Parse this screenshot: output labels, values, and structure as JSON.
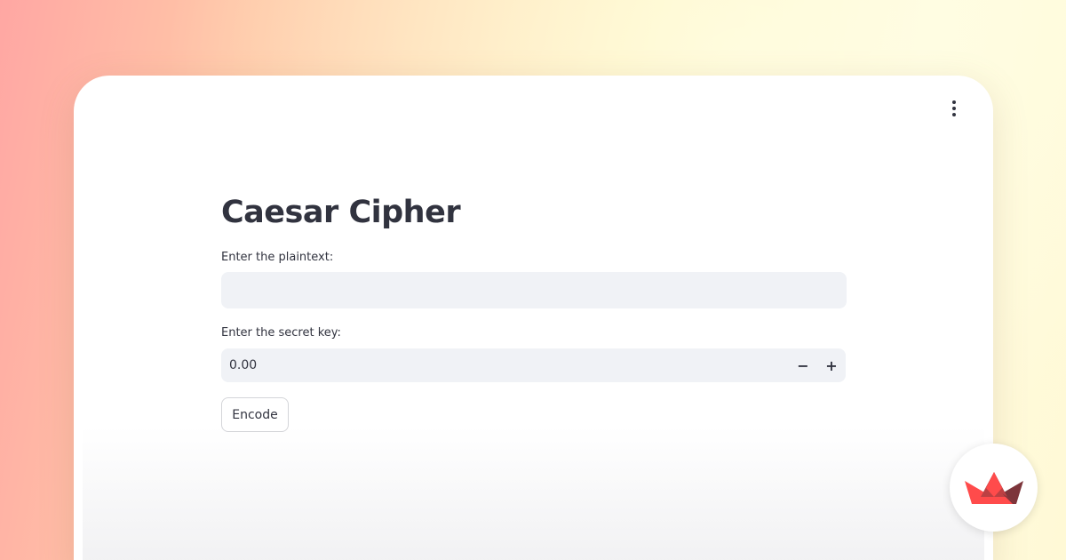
{
  "app": {
    "title": "Caesar Cipher"
  },
  "form": {
    "plaintext_label": "Enter the plaintext:",
    "plaintext_value": "",
    "key_label": "Enter the secret key:",
    "key_value": "0.00",
    "decrement_symbol": "−",
    "increment_symbol": "+",
    "submit_label": "Encode"
  },
  "icons": {
    "menu": "kebab-menu-icon",
    "logo": "streamlit-logo"
  },
  "colors": {
    "text": "#31333f",
    "input_bg": "#f0f2f6",
    "logo_red": "#ff4b4b",
    "logo_dark": "#7d353b"
  }
}
